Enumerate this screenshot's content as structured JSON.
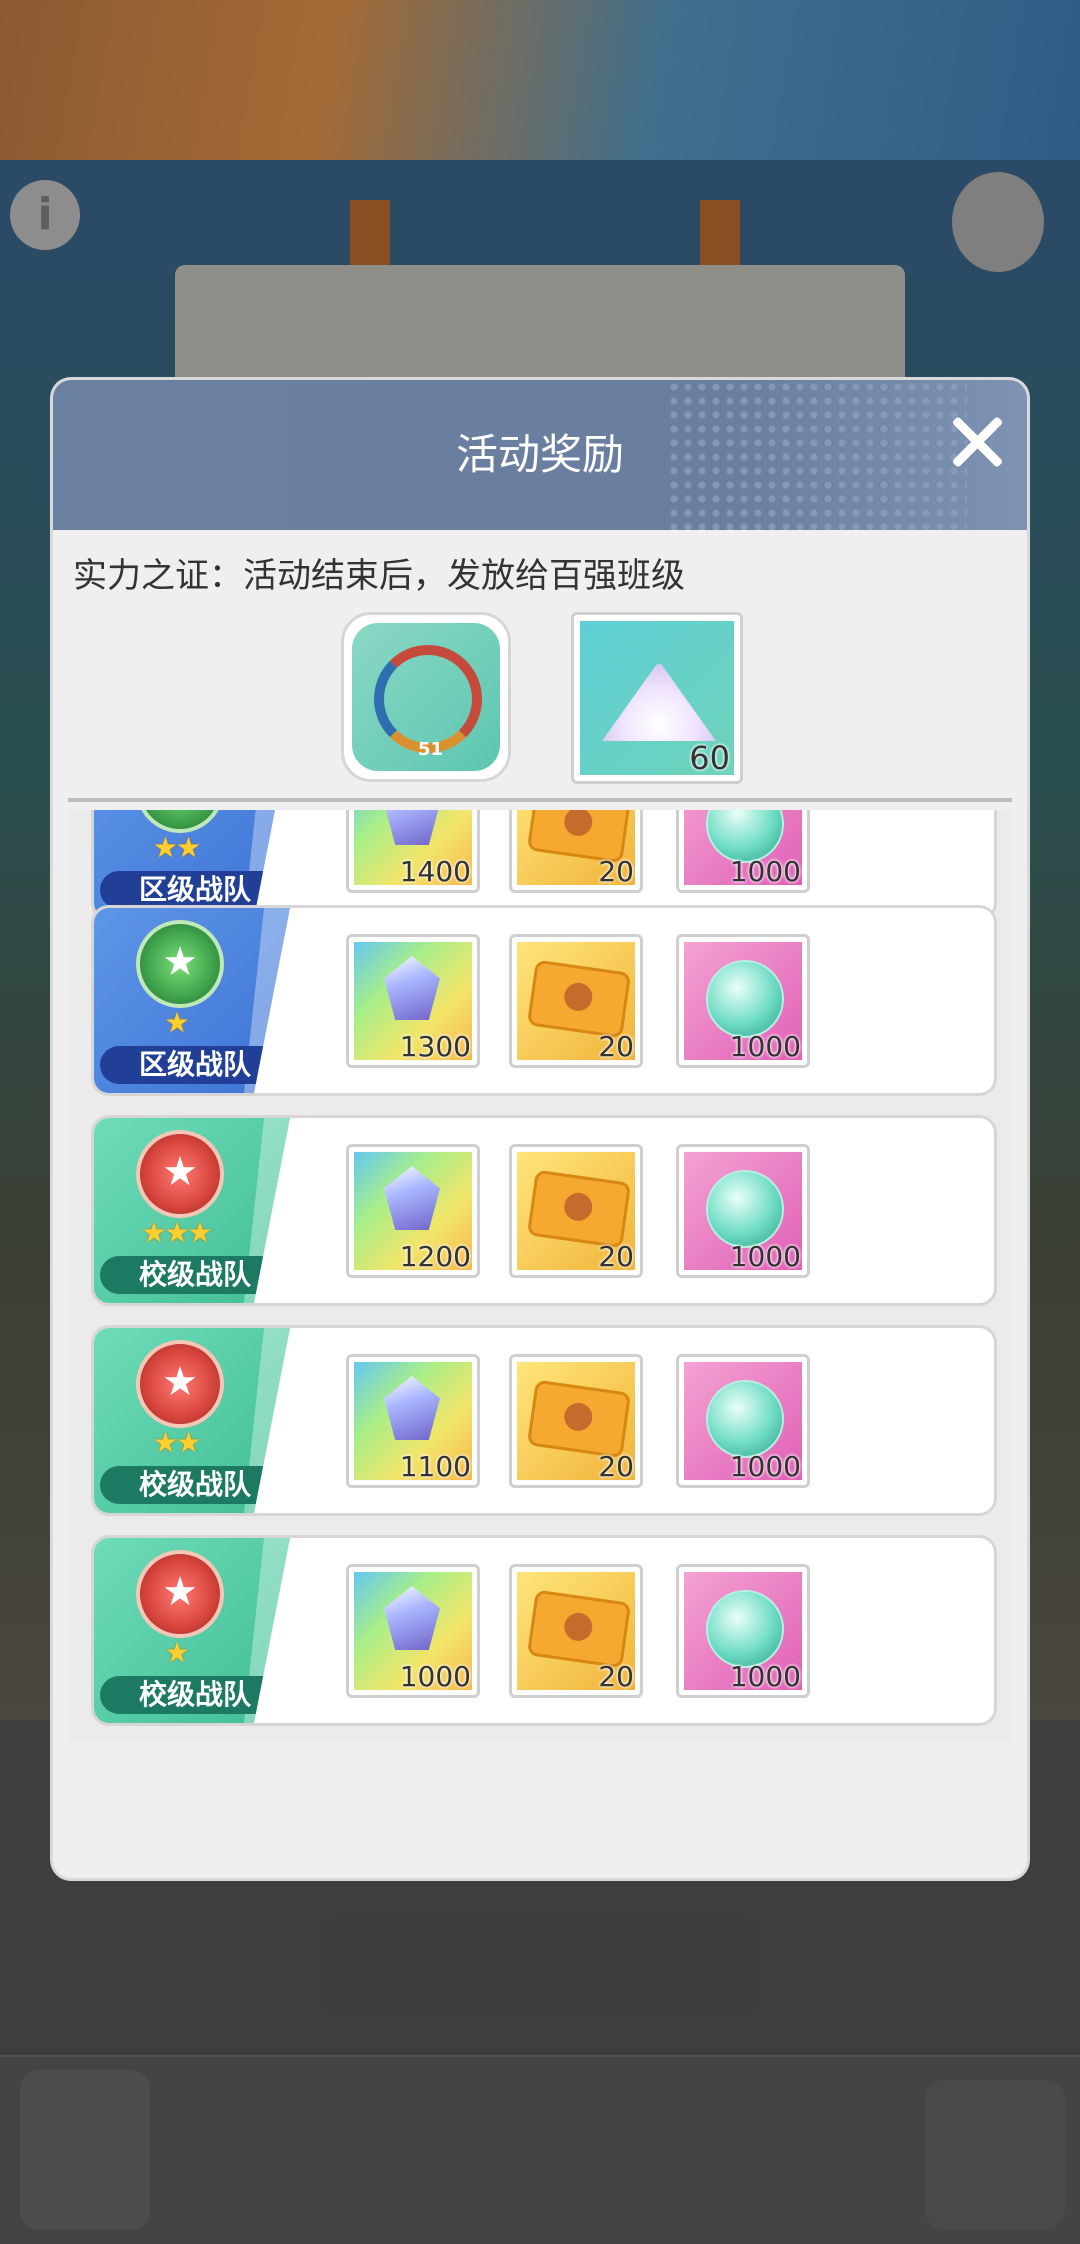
{
  "modal": {
    "title": "活动奖励",
    "subtitle": "实力之证：活动结束后，发放给百强班级",
    "top_rewards": [
      {
        "icon": "frame-icon",
        "label": "51"
      },
      {
        "icon": "sand-icon",
        "quantity": "60"
      }
    ]
  },
  "reward_rows": [
    {
      "tier_label": "区级战队",
      "tier": "district",
      "stars": "★★",
      "gem": "1400",
      "ticket": "20",
      "orb": "1000"
    },
    {
      "tier_label": "区级战队",
      "tier": "district",
      "stars": "★",
      "gem": "1300",
      "ticket": "20",
      "orb": "1000"
    },
    {
      "tier_label": "校级战队",
      "tier": "school",
      "stars": "★★★",
      "gem": "1200",
      "ticket": "20",
      "orb": "1000"
    },
    {
      "tier_label": "校级战队",
      "tier": "school",
      "stars": "★★",
      "gem": "1100",
      "ticket": "20",
      "orb": "1000"
    },
    {
      "tier_label": "校级战队",
      "tier": "school",
      "stars": "★",
      "gem": "1000",
      "ticket": "20",
      "orb": "1000"
    }
  ]
}
